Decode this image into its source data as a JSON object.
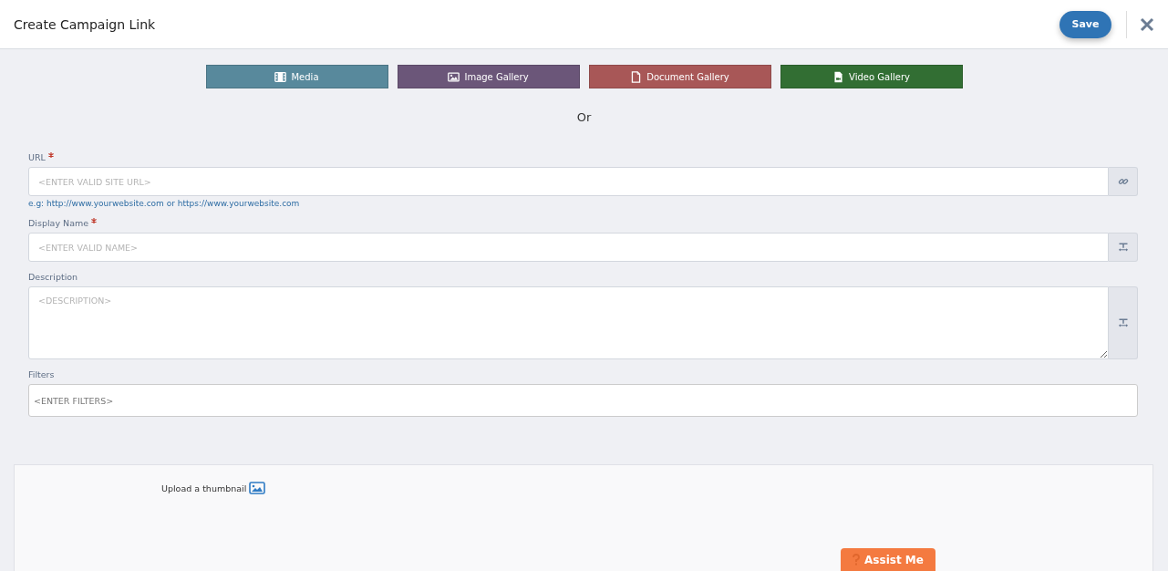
{
  "dialog": {
    "title": "Create Campaign Link",
    "save_button": "Save"
  },
  "source_buttons": [
    {
      "label": "Media",
      "kind": "film",
      "color": "#58899c"
    },
    {
      "label": "Image Gallery",
      "kind": "image",
      "color": "#6b5679"
    },
    {
      "label": "Document Gallery",
      "kind": "document",
      "color": "#a85757"
    },
    {
      "label": "Video Gallery",
      "kind": "video",
      "color": "#326e33"
    }
  ],
  "separator": "Or",
  "fields": [
    {
      "label": "URL",
      "required": true,
      "kind": "input",
      "placeholder": "<ENTER VALID SITE URL>",
      "addon": {
        "kind": "link"
      },
      "hint": "e.g: http://www.yourwebsite.com or https://www.yourwebsite.com"
    },
    {
      "label": "Display Name",
      "required": true,
      "kind": "input",
      "placeholder": "<ENTER VALID NAME>",
      "addon": {
        "kind": "text-width"
      }
    },
    {
      "label": "Description",
      "required": false,
      "kind": "textarea",
      "placeholder": "<DESCRIPTION>",
      "addon": {
        "kind": "text-width"
      }
    },
    {
      "label": "Filters",
      "required": false,
      "kind": "tags",
      "placeholder": "<ENTER FILTERS>"
    }
  ],
  "thumbnail": {
    "label": "Upload a thumbnail"
  },
  "assist_button": {
    "label": "Assist Me"
  }
}
